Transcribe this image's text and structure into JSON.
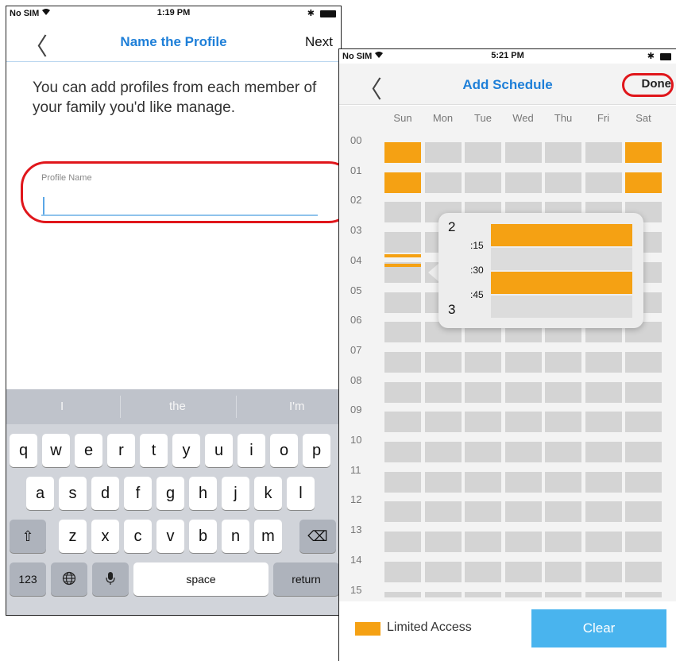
{
  "left_screen": {
    "status": {
      "carrier": "No SIM",
      "wifi_icon": "wifi-icon",
      "time": "1:19 PM",
      "bluetooth": "✱"
    },
    "nav": {
      "back_icon": "chevron-left-icon",
      "back_glyph": "〈",
      "title": "Name the Profile",
      "next_label": "Next"
    },
    "intro_text": "You can add profiles from each member of your family you'd like manage.",
    "field": {
      "label": "Profile Name",
      "value": ""
    },
    "keyboard": {
      "suggestions": [
        "I",
        "the",
        "I'm"
      ],
      "row1": [
        "q",
        "w",
        "e",
        "r",
        "t",
        "y",
        "u",
        "i",
        "o",
        "p"
      ],
      "row2": [
        "a",
        "s",
        "d",
        "f",
        "g",
        "h",
        "j",
        "k",
        "l"
      ],
      "row3": [
        "z",
        "x",
        "c",
        "v",
        "b",
        "n",
        "m"
      ],
      "shift_glyph": "⇧",
      "backspace_glyph": "⌫",
      "numbers_label": "123",
      "globe_glyph": "🌐",
      "mic_glyph": "🎙",
      "space_label": "space",
      "return_label": "return"
    }
  },
  "right_screen": {
    "status": {
      "carrier": "No SIM",
      "wifi_icon": "wifi-icon",
      "time": "5:21 PM",
      "bluetooth": "✱"
    },
    "nav": {
      "back_icon": "chevron-left-icon",
      "back_glyph": "〈",
      "title": "Add Schedule",
      "done_label": "Done"
    },
    "days": [
      "Sun",
      "Mon",
      "Tue",
      "Wed",
      "Thu",
      "Fri",
      "Sat"
    ],
    "hours": [
      "00",
      "01",
      "02",
      "03",
      "04",
      "05",
      "06",
      "07",
      "08",
      "09",
      "10",
      "11",
      "12",
      "13",
      "14",
      "15"
    ],
    "limited_cells": [
      {
        "day": "Sun",
        "hour": "00"
      },
      {
        "day": "Sat",
        "hour": "00"
      },
      {
        "day": "Sun",
        "hour": "01"
      },
      {
        "day": "Sat",
        "hour": "01"
      }
    ],
    "popup": {
      "hour_start": "2",
      "hour_end": "3",
      "quarters": [
        ":15",
        ":30",
        ":45"
      ],
      "slots_on": [
        true,
        false,
        true,
        false
      ]
    },
    "legend_label": "Limited Access",
    "clear_label": "Clear",
    "colors": {
      "limited": "#f5a113",
      "accent": "#1e7fd8",
      "clear_button": "#49b4ee",
      "highlight": "#e0161b"
    }
  }
}
